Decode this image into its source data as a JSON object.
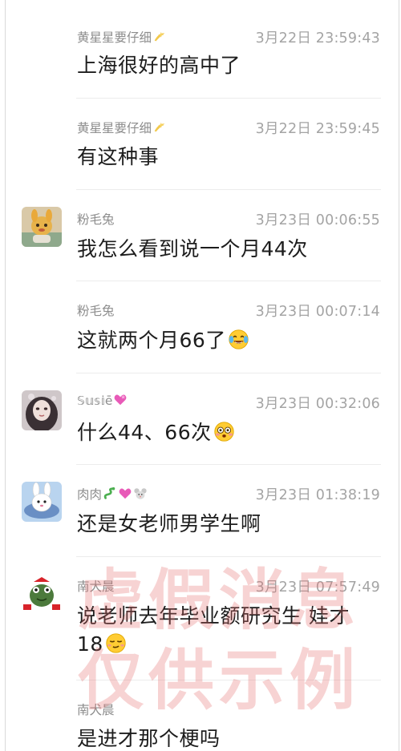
{
  "messages": [
    {
      "name": "黄星星要仔细",
      "time": "3月22日 23:59:43",
      "text": "上海很好的高中了",
      "avatar": "none",
      "name_icon": "sparkle-icon",
      "trailing_emoji": ""
    },
    {
      "name": "黄星星要仔细",
      "time": "3月22日 23:59:45",
      "text": "有这种事",
      "avatar": "none",
      "name_icon": "sparkle-icon",
      "trailing_emoji": ""
    },
    {
      "name": "粉毛兔",
      "time": "3月23日 00:06:55",
      "text": "我怎么看到说一个月44次",
      "avatar": "cartoon-animal-avatar",
      "name_icon": "",
      "trailing_emoji": ""
    },
    {
      "name": "粉毛兔",
      "time": "3月23日 00:07:14",
      "text": "这就两个月66了",
      "avatar": "none",
      "name_icon": "",
      "trailing_emoji": "laughing-tears-emoji"
    },
    {
      "name": "𝕊𝕦𝕤𝕚ē",
      "time": "3月23日 00:32:06",
      "text": "什么44、66次",
      "avatar": "portrait-avatar",
      "name_icon": "pink-heart-icon",
      "trailing_emoji": "flushed-face-emoji"
    },
    {
      "name": "肉肉",
      "time": "3月23日 01:38:19",
      "text": "还是女老师男学生啊",
      "avatar": "cartoon-rabbit-avatar",
      "name_icon": "snake-heart-mouse-icons",
      "trailing_emoji": ""
    },
    {
      "name": "南犬晨",
      "time": "3月23日 07:57:49",
      "text_line1": "说老师去年毕业额研究生 娃才",
      "text_line2": "18",
      "avatar": "green-frog-avatar",
      "name_icon": "",
      "trailing_emoji": "smirk-face-emoji"
    },
    {
      "name": "南犬晨",
      "time": "",
      "text": "是进才那个梗吗",
      "avatar": "none",
      "name_icon": "",
      "trailing_emoji": ""
    }
  ],
  "watermark": {
    "line1": "虚假消息",
    "line2": "仅供示例"
  },
  "colors": {
    "name": "#8d8d8d",
    "time": "#a4a4a4",
    "text": "#1d1d1d",
    "watermark": "#e66e6e"
  }
}
